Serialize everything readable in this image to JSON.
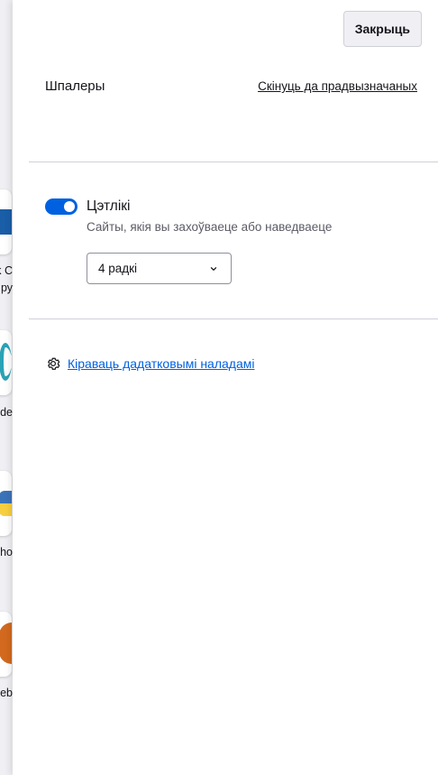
{
  "close_button": "Закрыць",
  "wallpaper": {
    "title": "Шпалеры",
    "reset_link": "Скінуць да прадвызначаных"
  },
  "shortcuts": {
    "toggle_label": "Цэтлікі",
    "toggle_on": true,
    "description": "Сайты, якія вы захоўваеце або наведваеце",
    "rows_select": "4 радкі"
  },
  "manage_link": "Кіраваць дадатковымі наладамі",
  "background_page": {
    "labels": [
      "k C",
      "ру",
      "ode",
      "ho",
      "teb"
    ]
  },
  "colors": {
    "accent": "#0061e0",
    "divider": "#cfcfd8",
    "button_bg": "#f0f0f4"
  },
  "icons": [
    "gear-icon",
    "chevron-down-icon"
  ]
}
